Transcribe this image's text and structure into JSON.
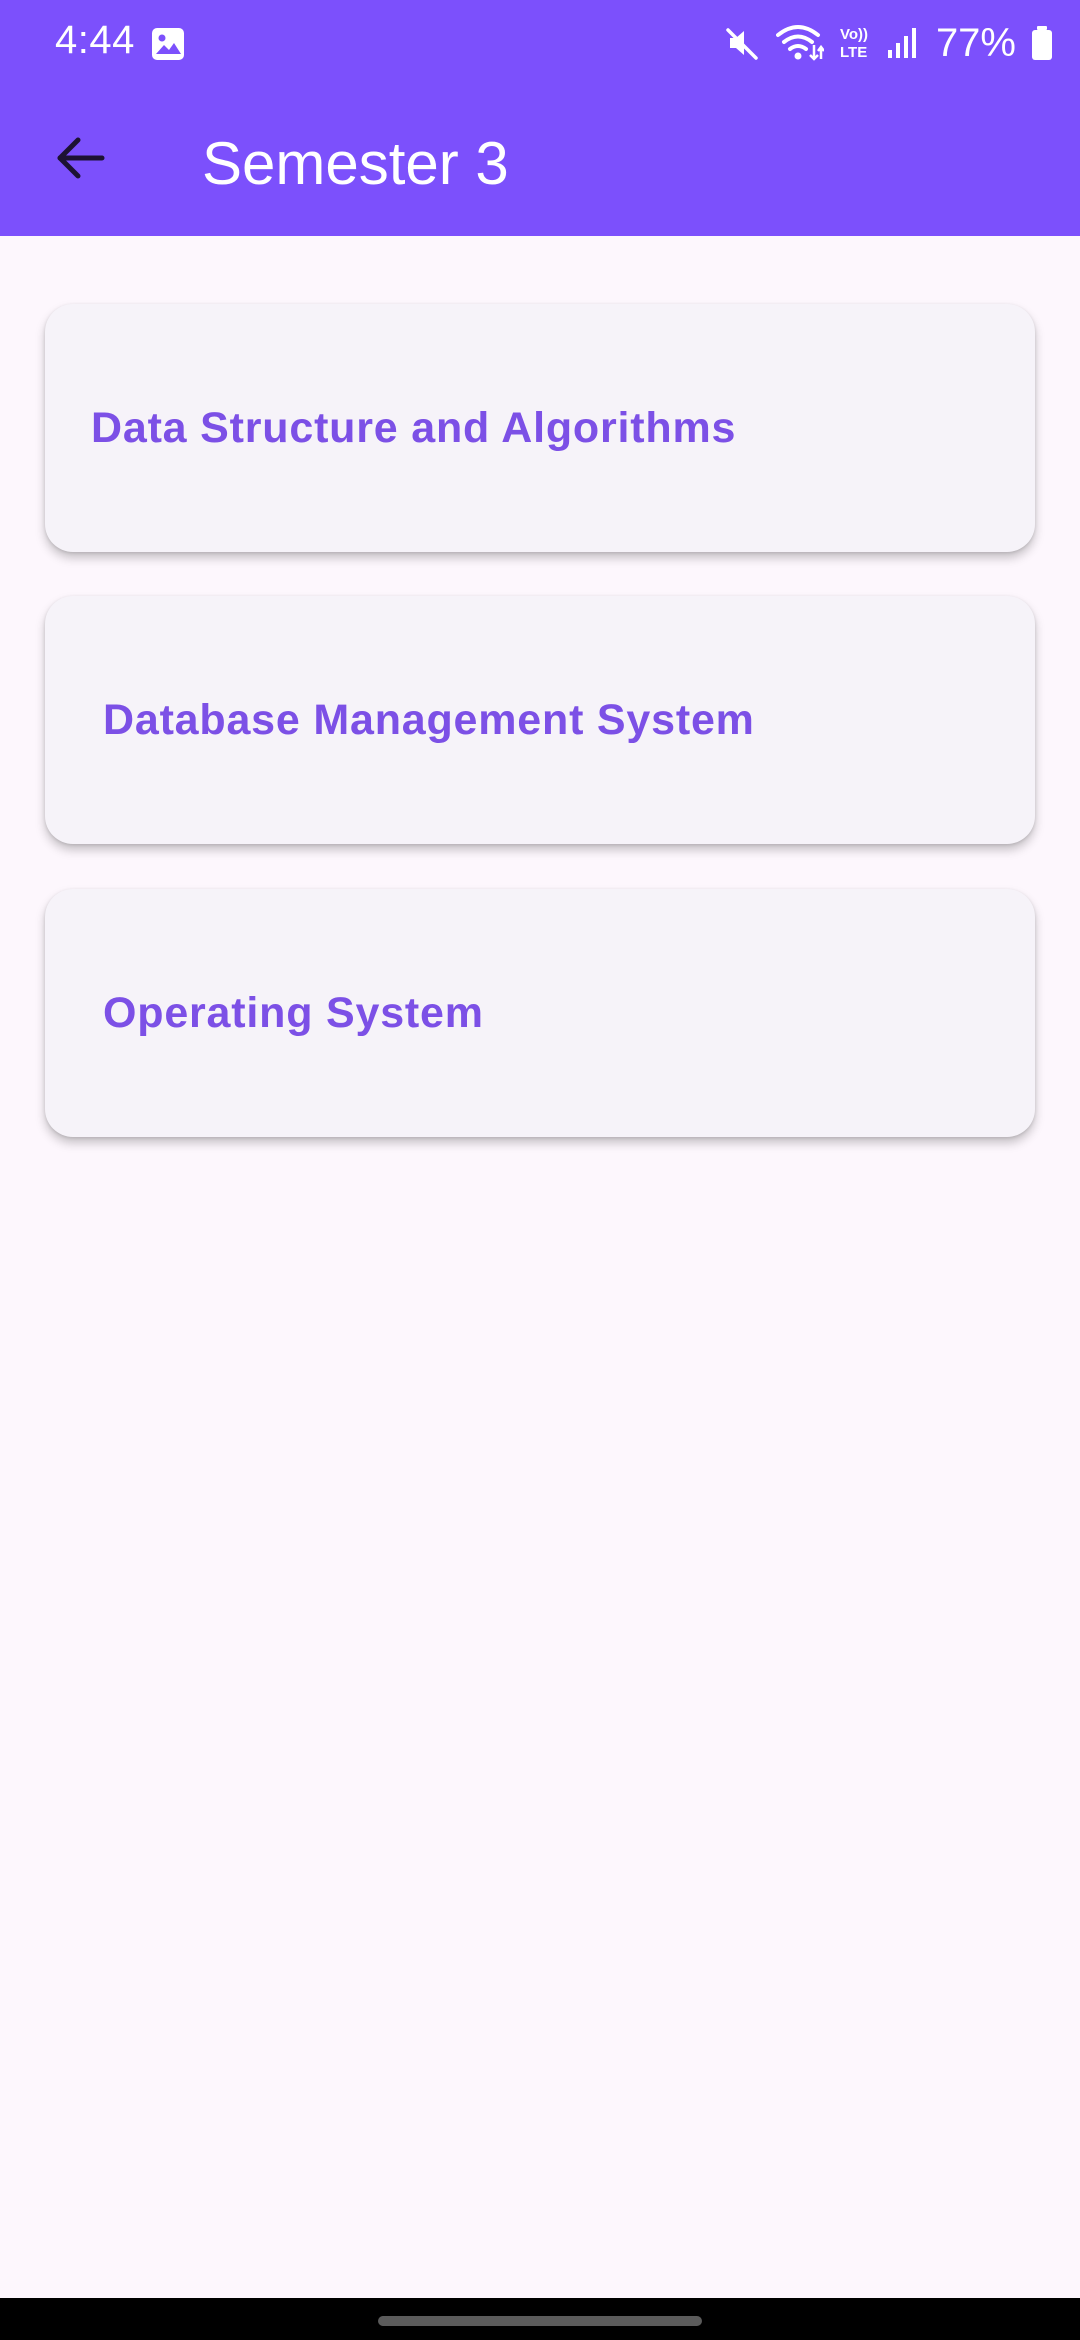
{
  "status_bar": {
    "time": "4:44",
    "battery": "77%",
    "icons": [
      "gallery-icon",
      "mute-icon",
      "wifi-icon",
      "volte-icon",
      "signal-icon",
      "battery-icon"
    ]
  },
  "app_bar": {
    "title": "Semester 3",
    "back_icon": "arrow-back-icon"
  },
  "subjects": [
    {
      "label": "Data Structure and Algorithms"
    },
    {
      "label": "Database Management System"
    },
    {
      "label": "Operating System"
    }
  ],
  "colors": {
    "primary": "#7c50fc",
    "subject_text": "#7c50e6",
    "card_bg": "#f6f3f9",
    "page_bg": "#fdf7fd"
  }
}
